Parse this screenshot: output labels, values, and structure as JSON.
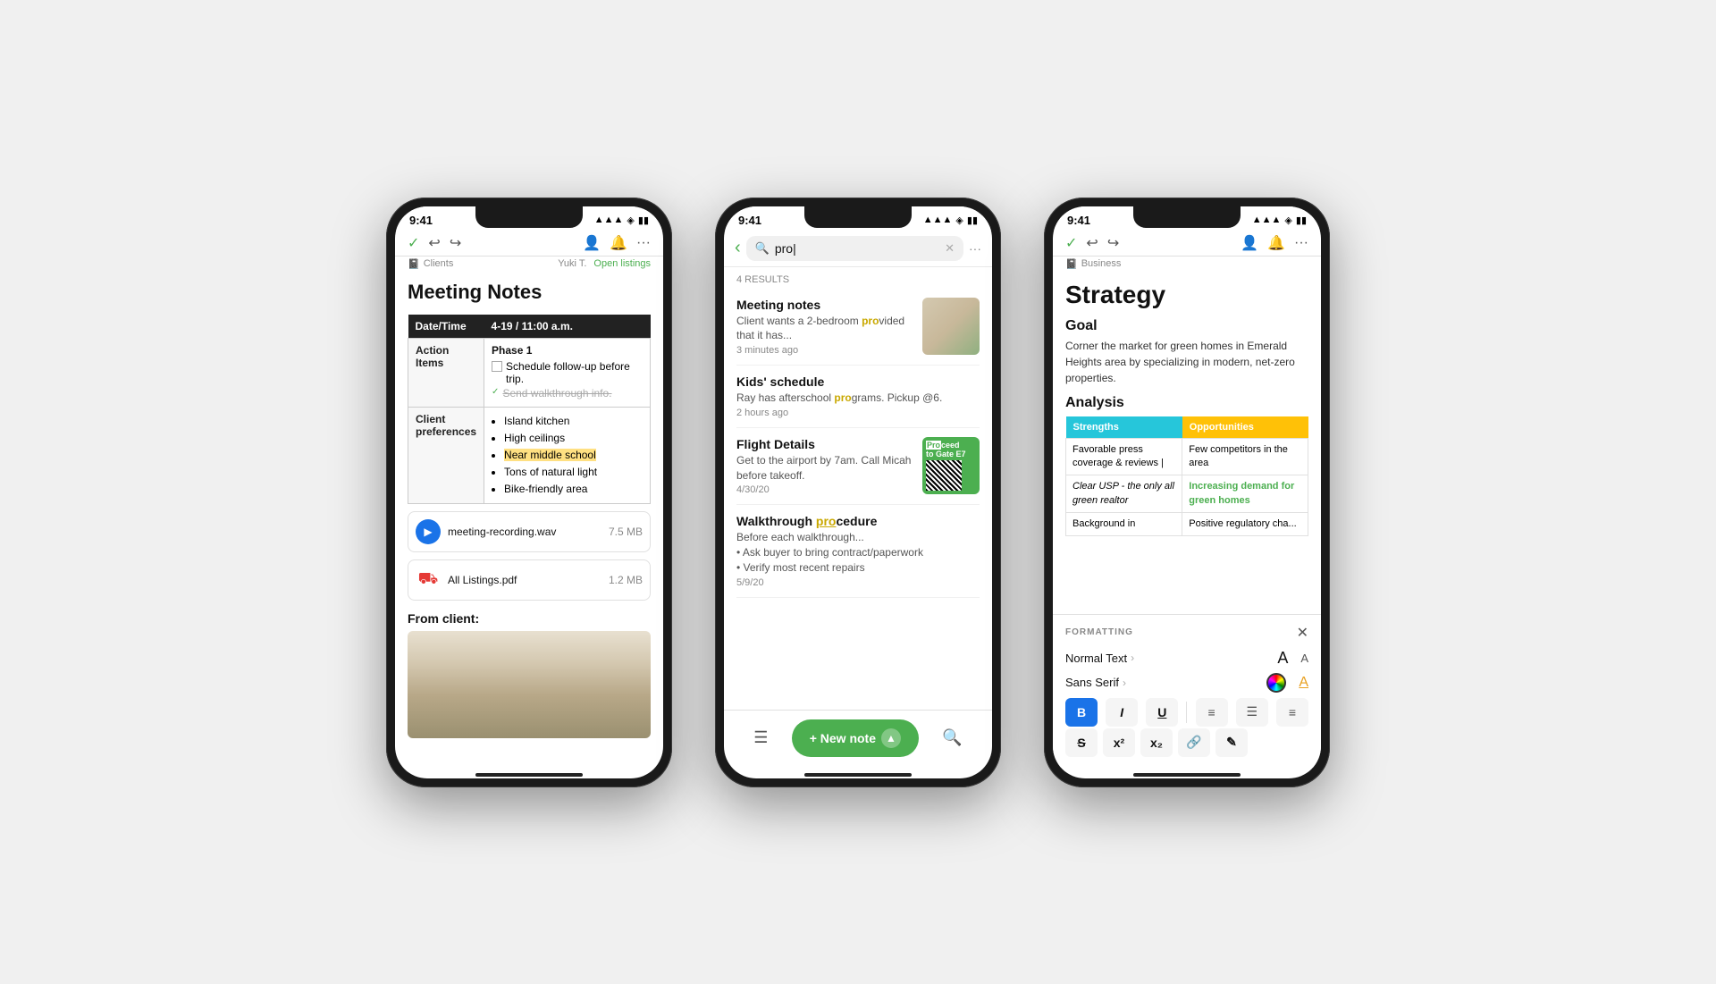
{
  "scene": {
    "bg": "#f0f0f0"
  },
  "phone1": {
    "time": "9:41",
    "breadcrumb": "Clients",
    "user": "Yuki T.",
    "link": "Open listings",
    "title": "Meeting Notes",
    "table": {
      "col1": "Date/Time",
      "col2": "4-19 / 11:00 a.m.",
      "row2_label": "Action Items",
      "phase": "Phase 1",
      "check1": "Schedule follow-up before trip.",
      "check2": "Send walkthrough info.",
      "row3_label": "Client preferences",
      "bullets": [
        "Island kitchen",
        "High ceilings",
        "Near middle school",
        "Tons of natural light",
        "Bike-friendly area"
      ]
    },
    "attachment1": {
      "name": "meeting-recording.wav",
      "size": "7.5 MB"
    },
    "attachment2": {
      "name": "All Listings.pdf",
      "size": "1.2 MB"
    },
    "from_client": "From client:"
  },
  "phone2": {
    "time": "9:41",
    "search_value": "pro",
    "results_count": "4 RESULTS",
    "results": [
      {
        "title": "Meeting notes",
        "snippet": "Client wants a 2-bedroom pro̲vided that it has...",
        "time": "3 minutes ago",
        "has_thumb": true,
        "thumb_type": "room"
      },
      {
        "title": "Kids' schedule",
        "snippet": "Ray has afterschool pro̲grams. Pickup @6.",
        "time": "2 hours ago",
        "has_thumb": false
      },
      {
        "title": "Flight Details",
        "snippet": "Get to the airport by 7am. Call Micah before takeoff.",
        "time": "4/30/20",
        "has_thumb": true,
        "thumb_type": "boarding"
      },
      {
        "title": "Walkthrough pro̲cedure",
        "snippet_bullets": [
          "Ask buyer to bring contract/paperwork",
          "Verify most recent repairs"
        ],
        "snippet_prefix": "Before each walkthrough...",
        "time": "5/9/20",
        "has_thumb": false
      }
    ],
    "new_note": "+ New note"
  },
  "phone3": {
    "time": "9:41",
    "breadcrumb": "Business",
    "title": "Strategy",
    "goal_heading": "Goal",
    "goal_text": "Corner the market for green homes in Emerald Heights area by specializing in modern, net-zero properties.",
    "analysis_heading": "Analysis",
    "swot": {
      "col1": "Strengths",
      "col2": "Opportunities",
      "rows": [
        [
          "Favorable press coverage & reviews |",
          "Few competitors in the area"
        ],
        [
          "Clear USP - the only all green realtor",
          "Increasing demand for green homes"
        ],
        [
          "Background in",
          "Positive regulatory cha..."
        ]
      ]
    },
    "formatting": {
      "label": "FORMATTING",
      "normal_text": "Normal Text",
      "sans_serif": "Sans Serif",
      "bold": "B",
      "italic": "I",
      "underline": "U",
      "strikethrough": "S",
      "superscript": "x²",
      "subscript": "x₂"
    }
  }
}
